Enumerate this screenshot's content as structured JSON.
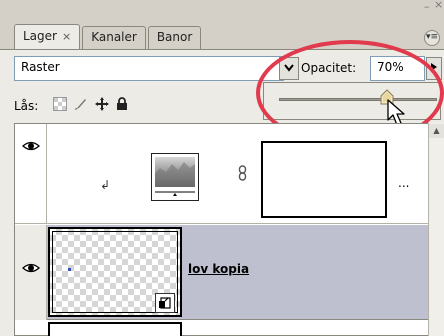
{
  "window": {
    "minimize": "–",
    "close": "×"
  },
  "tabs": [
    {
      "label": "Lager",
      "close": "×"
    },
    {
      "label": "Kanaler"
    },
    {
      "label": "Banor"
    }
  ],
  "blend_mode": {
    "value": "Raster"
  },
  "opacity": {
    "label": "Opacitet:",
    "value": "70%",
    "percent": 70
  },
  "lock": {
    "label": "Lås:"
  },
  "layers": [
    {
      "type": "adjustment",
      "clip_arrow": "↲",
      "more": "..."
    },
    {
      "type": "smart-object",
      "name": "lov kopia"
    }
  ],
  "colors": {
    "annotation": "#e03a4c",
    "selected_row": "#bec0cf"
  }
}
